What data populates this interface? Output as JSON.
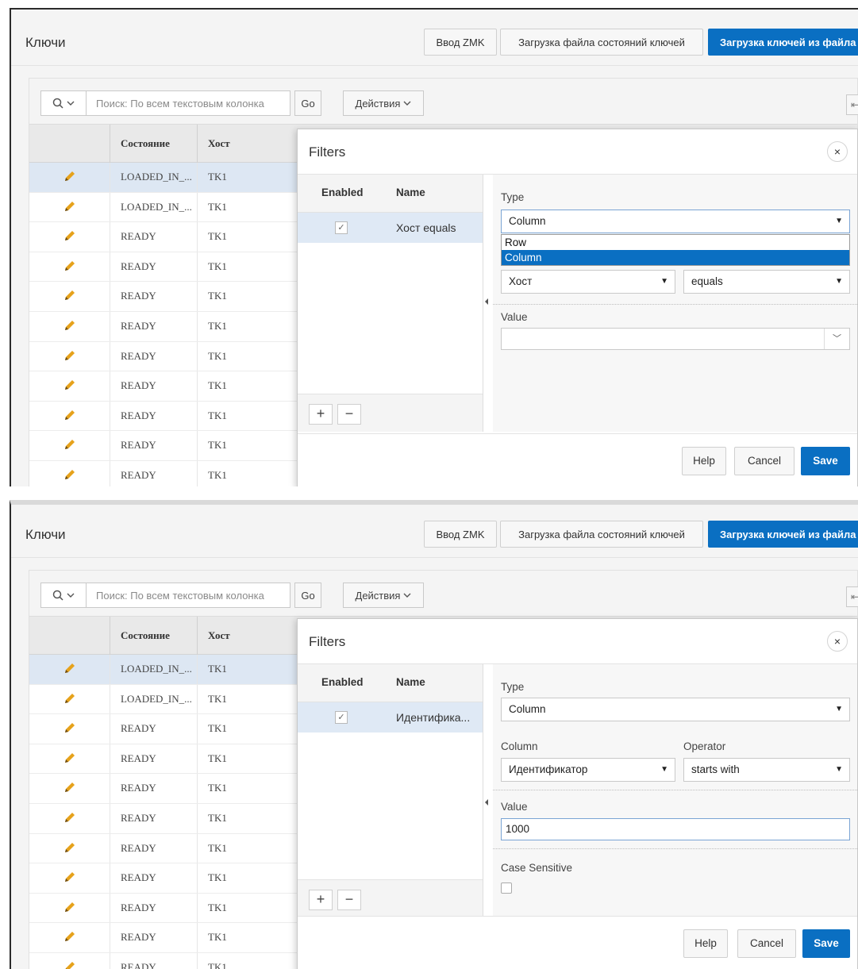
{
  "screens": [
    {
      "region_title": "Ключи",
      "buttons": {
        "zmk": "Ввод ZMK",
        "load_state": "Загрузка файла состояний ключей",
        "load_keys": "Загрузка ключей из файла"
      },
      "toolbar": {
        "search_placeholder": "Поиск: По всем текстовым колонка",
        "go": "Go",
        "actions": "Действия",
        "right_stub": "⇤"
      },
      "grid": {
        "headers": [
          "Состояние",
          "Хост"
        ],
        "rows": [
          {
            "state": "LOADED_IN_...",
            "host": "TK1",
            "selected": true
          },
          {
            "state": "LOADED_IN_...",
            "host": "TK1"
          },
          {
            "state": "READY",
            "host": "TK1"
          },
          {
            "state": "READY",
            "host": "TK1"
          },
          {
            "state": "READY",
            "host": "TK1"
          },
          {
            "state": "READY",
            "host": "TK1"
          },
          {
            "state": "READY",
            "host": "TK1"
          },
          {
            "state": "READY",
            "host": "TK1"
          },
          {
            "state": "READY",
            "host": "TK1"
          },
          {
            "state": "READY",
            "host": "TK1"
          },
          {
            "state": "READY",
            "host": "TK1"
          }
        ]
      },
      "dialog": {
        "title": "Filters",
        "close": "×",
        "list_headers": {
          "enabled": "Enabled",
          "name": "Name"
        },
        "filters": [
          {
            "enabled": true,
            "name": "Хост equals"
          }
        ],
        "add": "+",
        "remove": "−",
        "type_label": "Type",
        "type_value": "Column",
        "type_options": [
          "Row",
          "Column"
        ],
        "type_selected_option": "Column",
        "column_value": "Хост",
        "operator_value": "equals",
        "value_label": "Value",
        "value_text": "",
        "help": "Help",
        "cancel": "Cancel",
        "save": "Save"
      }
    },
    {
      "region_title": "Ключи",
      "buttons": {
        "zmk": "Ввод ZMK",
        "load_state": "Загрузка файла состояний ключей",
        "load_keys": "Загрузка ключей из файла"
      },
      "toolbar": {
        "search_placeholder": "Поиск: По всем текстовым колонка",
        "go": "Go",
        "actions": "Действия",
        "right_stub": "⇤"
      },
      "grid": {
        "headers": [
          "Состояние",
          "Хост"
        ],
        "rows": [
          {
            "state": "LOADED_IN_...",
            "host": "TK1",
            "selected": true
          },
          {
            "state": "LOADED_IN_...",
            "host": "TK1"
          },
          {
            "state": "READY",
            "host": "TK1"
          },
          {
            "state": "READY",
            "host": "TK1"
          },
          {
            "state": "READY",
            "host": "TK1"
          },
          {
            "state": "READY",
            "host": "TK1"
          },
          {
            "state": "READY",
            "host": "TK1"
          },
          {
            "state": "READY",
            "host": "TK1"
          },
          {
            "state": "READY",
            "host": "TK1"
          },
          {
            "state": "READY",
            "host": "TK1"
          },
          {
            "state": "READY",
            "host": "TK1"
          }
        ]
      },
      "dialog": {
        "title": "Filters",
        "close": "×",
        "list_headers": {
          "enabled": "Enabled",
          "name": "Name"
        },
        "filters": [
          {
            "enabled": true,
            "name": "Идентифика..."
          }
        ],
        "add": "+",
        "remove": "−",
        "type_label": "Type",
        "type_value": "Column",
        "column_label": "Column",
        "column_value": "Идентификатор",
        "operator_label": "Operator",
        "operator_value": "starts with",
        "value_label": "Value",
        "value_text": "1000",
        "case_label": "Case Sensitive",
        "case_checked": false,
        "help": "Help",
        "cancel": "Cancel",
        "save": "Save"
      }
    }
  ],
  "colors": {
    "accent": "#0a6fc2",
    "selected_row": "#dde7f3",
    "edit_icon": "#e6a21b"
  },
  "icons": {
    "search": "search-icon",
    "edit": "pencil-icon",
    "close": "close-icon",
    "chevron": "chevron-down-icon"
  }
}
